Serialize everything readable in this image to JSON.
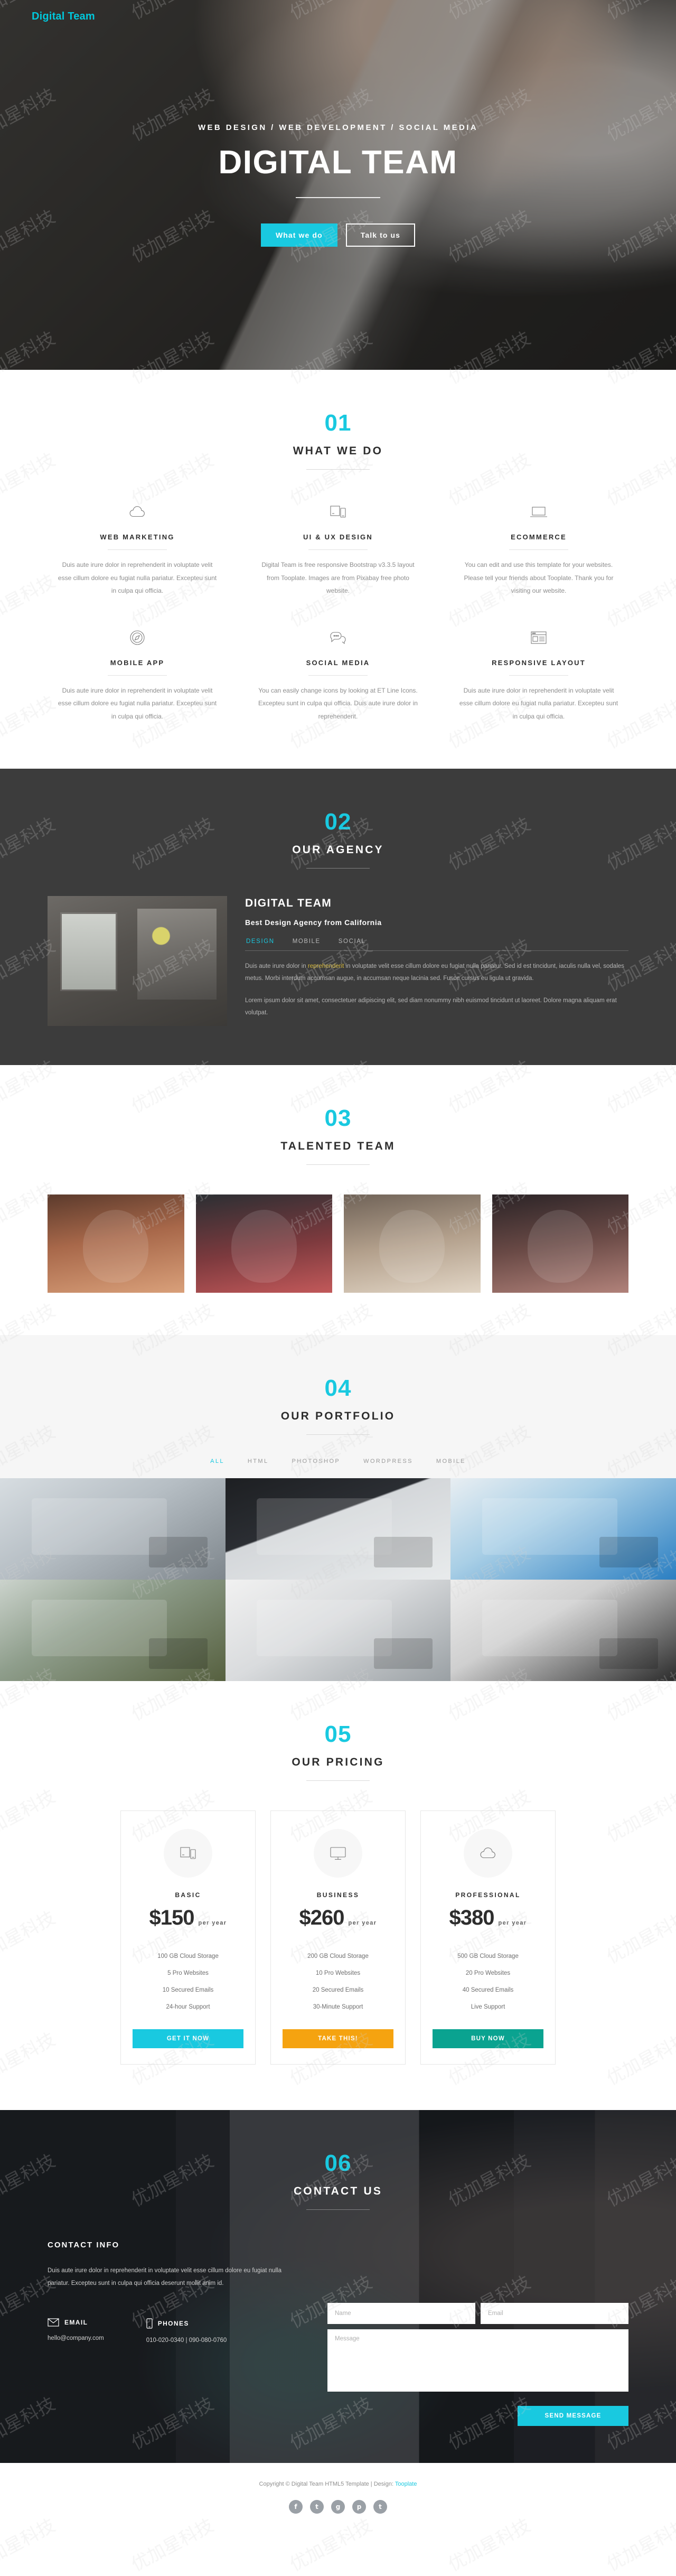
{
  "nav": {
    "logo": "Digital Team"
  },
  "hero": {
    "subtitle": "WEB DESIGN / WEB DEVELOPMENT / SOCIAL MEDIA",
    "title": "DIGITAL TEAM",
    "btn_primary": "What we do",
    "btn_secondary": "Talk to us"
  },
  "services": {
    "number": "01",
    "title": "WHAT WE DO",
    "items": [
      {
        "icon": "cloud-icon",
        "name": "WEB MARKETING",
        "text": "Duis aute irure dolor in reprehenderit in voluptate velit esse cillum dolore eu fugiat nulla pariatur. Excepteu sunt in culpa qui officia."
      },
      {
        "icon": "devices-icon",
        "name": "UI & UX DESIGN",
        "text": "Digital Team is free responsive Bootstrap v3.3.5 layout from Tooplate. Images are from Pixabay free photo website."
      },
      {
        "icon": "laptop-icon",
        "name": "ECOMMERCE",
        "text": "You can edit and use this template for your websites. Please tell your friends about Tooplate. Thank you for visiting our website."
      },
      {
        "icon": "compass-icon",
        "name": "MOBILE APP",
        "text": "Duis aute irure dolor in reprehenderit in voluptate velit esse cillum dolore eu fugiat nulla pariatur. Excepteu sunt in culpa qui officia."
      },
      {
        "icon": "chat-bubbles-icon",
        "name": "SOCIAL MEDIA",
        "text": "You can easily change icons by looking at ET Line Icons. Excepteu sunt in culpa qui officia. Duis aute irure dolor in reprehenderit."
      },
      {
        "icon": "browser-layout-icon",
        "name": "RESPONSIVE LAYOUT",
        "text": "Duis aute irure dolor in reprehenderit in voluptate velit esse cillum dolore eu fugiat nulla pariatur. Excepteu sunt in culpa qui officia."
      }
    ]
  },
  "agency": {
    "number": "02",
    "title": "OUR AGENCY",
    "heading": "DIGITAL TEAM",
    "subheading": "Best Design Agency from California",
    "tabs": [
      {
        "label": "DESIGN",
        "active": true
      },
      {
        "label": "MOBILE",
        "active": false
      },
      {
        "label": "SOCIAL",
        "active": false
      }
    ],
    "paragraph_1_a": "Duis aute irure dolor in ",
    "paragraph_1_hl": "reprehenderit",
    "paragraph_1_b": " in voluptate velit esse cillum dolore eu fugiat nulla pariatur. Sed id est tincidunt, iaculis nulla vel, sodales metus. Morbi interdum accumsan augue, in accumsan neque lacinia sed. Fusce cursus eu ligula ut gravida.",
    "paragraph_2": "Lorem ipsum dolor sit amet, consectetuer adipiscing elit, sed diam nonummy nibh euismod tincidunt ut laoreet. Dolore magna aliquam erat volutpat."
  },
  "team": {
    "number": "03",
    "title": "TALENTED TEAM",
    "members": [
      {
        "photo": "team-member-photo-1"
      },
      {
        "photo": "team-member-photo-2"
      },
      {
        "photo": "team-member-photo-3"
      },
      {
        "photo": "team-member-photo-4"
      }
    ]
  },
  "portfolio": {
    "number": "04",
    "title": "OUR PORTFOLIO",
    "filters": [
      {
        "label": "ALL",
        "active": true
      },
      {
        "label": "HTML",
        "active": false
      },
      {
        "label": "PHOTOSHOP",
        "active": false
      },
      {
        "label": "WORDPRESS",
        "active": false
      },
      {
        "label": "MOBILE",
        "active": false
      }
    ],
    "items": [
      {
        "photo": "portfolio-photo-1"
      },
      {
        "photo": "portfolio-photo-2"
      },
      {
        "photo": "portfolio-photo-3"
      },
      {
        "photo": "portfolio-photo-4"
      },
      {
        "photo": "portfolio-photo-5"
      },
      {
        "photo": "portfolio-photo-6"
      }
    ]
  },
  "pricing": {
    "number": "05",
    "title": "OUR PRICING",
    "plans": [
      {
        "icon": "devices-icon",
        "name": "BASIC",
        "amount": "$150",
        "per": "per year",
        "features": [
          "100 GB Cloud Storage",
          "5 Pro Websites",
          "10 Secured Emails",
          "24-hour Support"
        ],
        "cta": "GET IT NOW",
        "cta_color": "#19c9e0"
      },
      {
        "icon": "monitor-icon",
        "name": "BUSINESS",
        "amount": "$260",
        "per": "per year",
        "features": [
          "200 GB Cloud Storage",
          "10 Pro Websites",
          "20 Secured Emails",
          "30-Minute Support"
        ],
        "cta": "TAKE THIS!",
        "cta_color": "#f5a310"
      },
      {
        "icon": "cloud-icon",
        "name": "PROFESSIONAL",
        "amount": "$380",
        "per": "per year",
        "features": [
          "500 GB Cloud Storage",
          "20 Pro Websites",
          "40 Secured Emails",
          "Live Support"
        ],
        "cta": "BUY NOW",
        "cta_color": "#0aa390"
      }
    ]
  },
  "contact": {
    "number": "06",
    "title": "CONTACT US",
    "info_title": "CONTACT INFO",
    "info_text": "Duis aute irure dolor in reprehenderit in voluptate velit esse cillum dolore eu fugiat nulla pariatur. Excepteu sunt in culpa qui officia deserunt mollit anim id.",
    "email_label": "EMAIL",
    "email_value": "hello@company.com",
    "phones_label": "PHONES",
    "phones_value": "010-020-0340 | 090-080-0760",
    "name_placeholder": "Name",
    "email_placeholder": "Email",
    "message_placeholder": "Message",
    "send_label": "SEND MESSAGE"
  },
  "footer": {
    "copyright_a": "Copyright © Digital Team HTML5 Template | Design: ",
    "copyright_link": "Tooplate",
    "socials": [
      {
        "icon": "facebook-icon",
        "glyph": "f"
      },
      {
        "icon": "twitter-icon",
        "glyph": "t"
      },
      {
        "icon": "google-plus-icon",
        "glyph": "g"
      },
      {
        "icon": "pinterest-icon",
        "glyph": "p"
      },
      {
        "icon": "tumblr-icon",
        "glyph": "t"
      }
    ]
  },
  "theme": {
    "accent": "#19c9e0",
    "dark": "#3c3c3c",
    "text": "#2d2d2d"
  }
}
